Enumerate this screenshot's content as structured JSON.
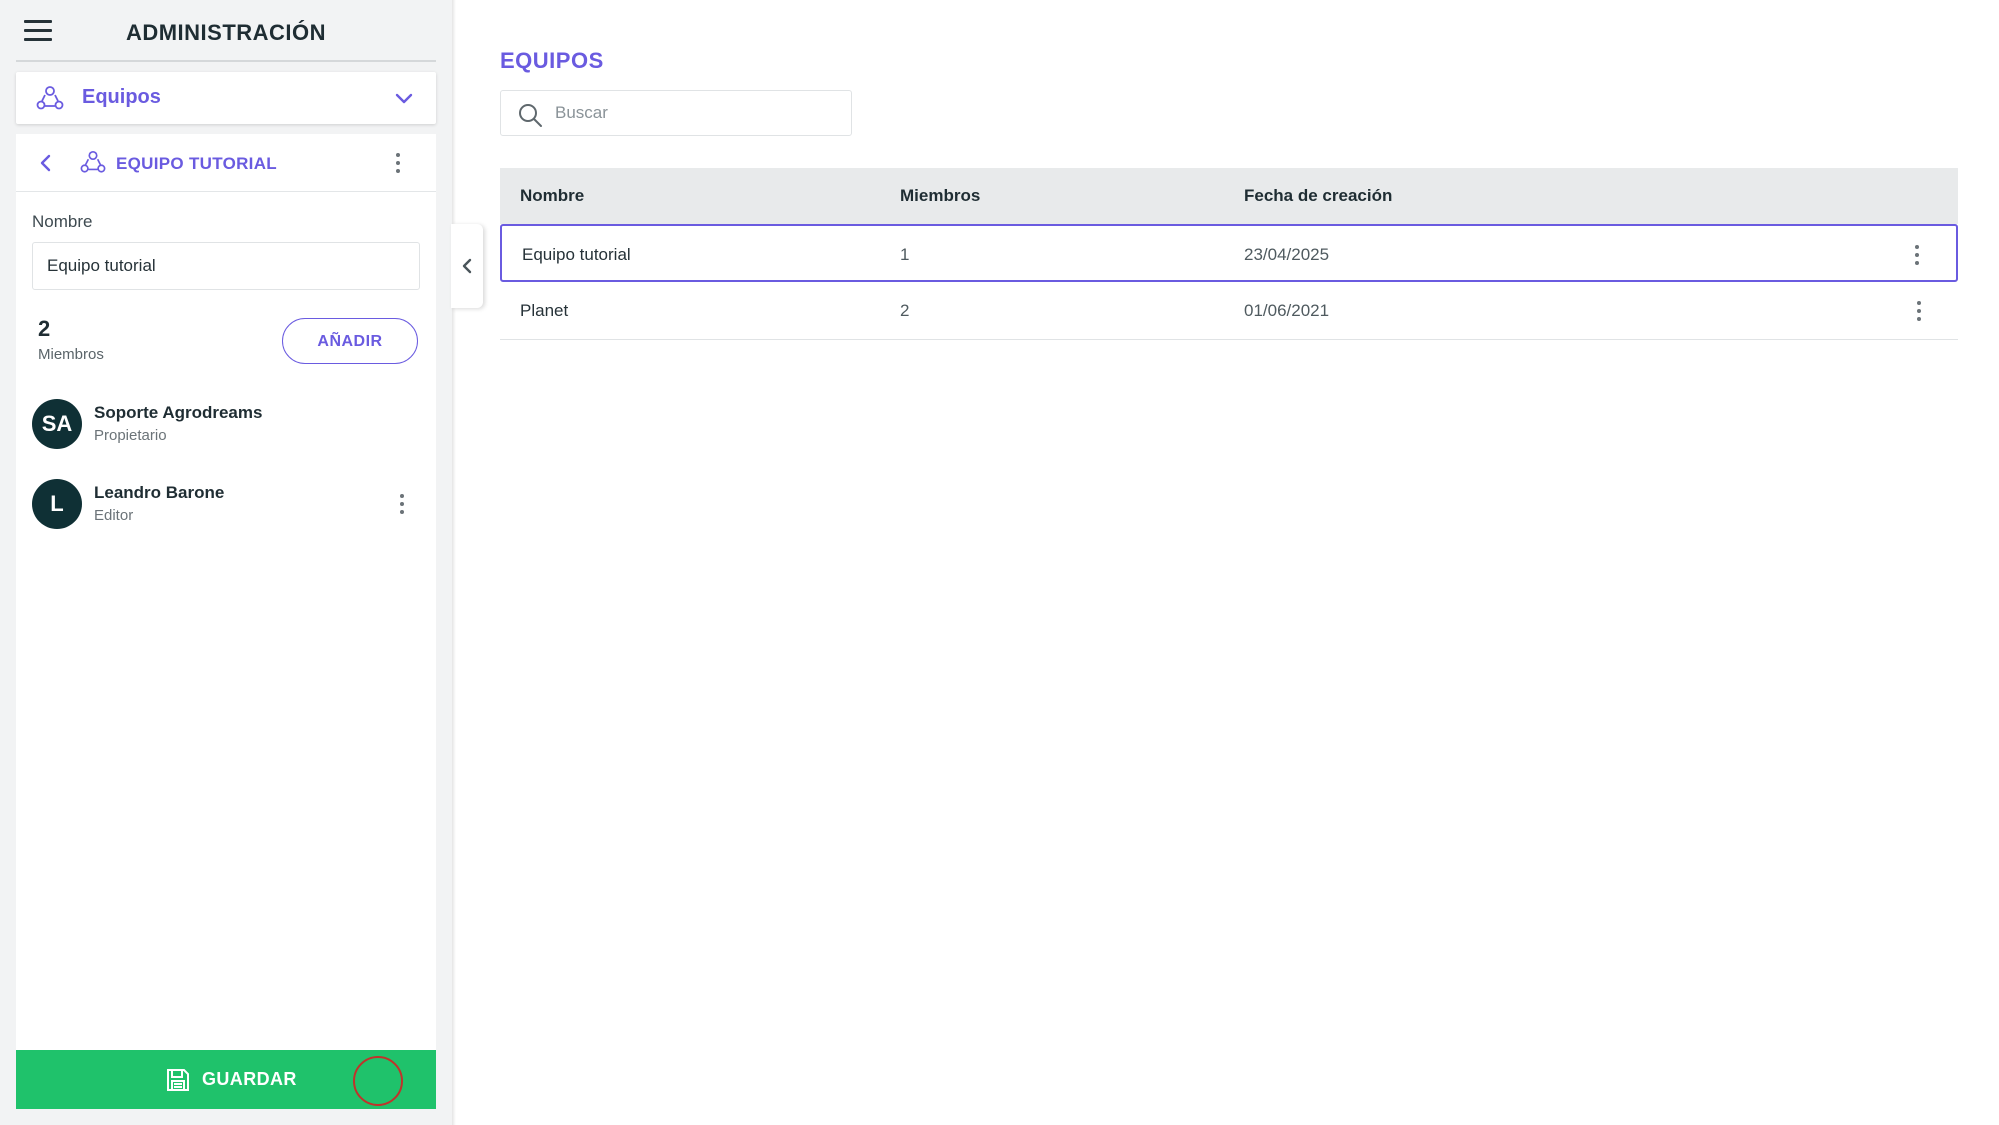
{
  "header": {
    "title": "ADMINISTRACIÓN"
  },
  "section_select": {
    "label": "Equipos"
  },
  "team_detail": {
    "title": "EQUIPO TUTORIAL",
    "name_label": "Nombre",
    "name_value": "Equipo tutorial",
    "members_count": "2",
    "members_label": "Miembros",
    "add_label": "AÑADIR",
    "members": [
      {
        "initials": "SA",
        "name": "Soporte Agrodreams",
        "role": "Propietario"
      },
      {
        "initials": "L",
        "name": "Leandro Barone",
        "role": "Editor"
      }
    ],
    "save_label": "GUARDAR"
  },
  "main": {
    "title": "EQUIPOS",
    "search": {
      "placeholder": "Buscar",
      "value": ""
    },
    "table": {
      "columns": [
        "Nombre",
        "Miembros",
        "Fecha de creación"
      ],
      "rows": [
        {
          "name": "Equipo tutorial",
          "members": "1",
          "created": "23/04/2025",
          "selected": true
        },
        {
          "name": "Planet",
          "members": "2",
          "created": "01/06/2021",
          "selected": false
        }
      ]
    }
  },
  "colors": {
    "accent": "#6a5be0",
    "save": "#1fc26b",
    "avatar": "#0f3035",
    "panel_bg": "#f2f3f4"
  }
}
